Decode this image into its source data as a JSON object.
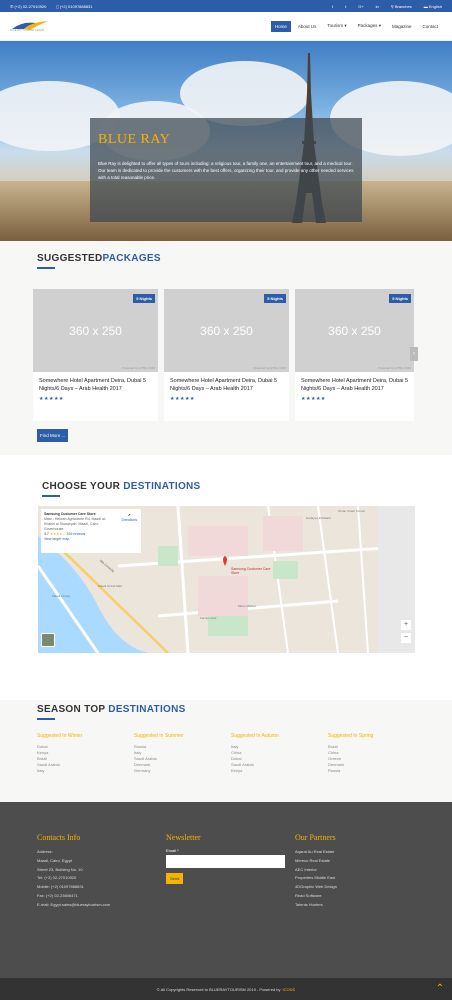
{
  "topbar": {
    "phone1": "(+2) 02-27010920",
    "phone2": "(+2) 01097888831",
    "social": [
      "f",
      "t",
      "G+",
      "in"
    ],
    "branches": "Branches",
    "language": "English"
  },
  "logo": {
    "text": "BLUE RAY TOURISM GROUP"
  },
  "menu": {
    "items": [
      "Home",
      "About Us",
      "Tourism",
      "Packages",
      "Magazine",
      "Contact"
    ]
  },
  "hero": {
    "title": "BLUE RAY",
    "desc": "Blue Ray is delighted to offer all types of tours including: a religious tour, a family one, an entertainment tour, and a medical tour. Our team is dedicated to provide the customers with the best offers, organizing their tour, and provide any other needed services with a total reasonable price."
  },
  "packages": {
    "title1": "SUGGESTED",
    "title2": "PACKAGES",
    "more": "Find More ...",
    "cards": [
      {
        "badge": "5 Nights",
        "img": "360 x 250",
        "powered": "Powered by HTML.COM",
        "title": "Somewhere Hotel Apartment Deira, Dubai 5 Nights/6 Days – Arab Health 2017",
        "stars": "★★★★★"
      },
      {
        "badge": "5 Nights",
        "img": "360 x 250",
        "powered": "Powered by HTML.COM",
        "title": "Somewhere Hotel Apartment Deira, Dubai 5 Nights/6 Days – Arab Health 2017",
        "stars": "★★★★★"
      },
      {
        "badge": "5 Nights",
        "img": "360 x 250",
        "powered": "Powered by HTML.COM",
        "title": "Somewhere Hotel Apartment Deira, Dubai 5 Nights/6 Days – Arab Health 2017",
        "stars": "★★★★★"
      }
    ]
  },
  "destinations": {
    "title1": "CHOOSE YOUR ",
    "title2": "DESTINATIONS"
  },
  "map": {
    "place": "Samsung Customer Care Store",
    "address": "Masr - Helwan Agriculture Rd, Maadi al-Khabiri al Sharqeyah, Maadi, Cairo Governorate",
    "rating": "3.7",
    "stars": "★★★★☆",
    "reviews": "326 reviews",
    "directions": "Directions",
    "larger": "View larger map",
    "pin_label": "Samsung Customer Care Store",
    "labels": [
      "Maadi Grand Mall",
      "Metro Market",
      "Family Land",
      "Maadi Library",
      "Hadayeq El Maadi",
      "Oman Smart School",
      "Nile Corniche"
    ]
  },
  "season": {
    "title1": "SEASON TOP ",
    "title2": "DESTINATIONS",
    "columns": [
      {
        "head": "Suggested In Winter",
        "items": [
          "Dubai",
          "Kenya",
          "Brazil",
          "Saudi Arabia",
          "Italy"
        ]
      },
      {
        "head": "Suggested In Summer",
        "items": [
          "Russia",
          "Italy",
          "Saudi Arabia",
          "Denmark",
          "Germany"
        ]
      },
      {
        "head": "Suggested In Autumn",
        "items": [
          "Italy",
          "China",
          "Dubai",
          "Saudi Arabia",
          "Kenya"
        ]
      },
      {
        "head": "Suggested In Spring",
        "items": [
          "Brazil",
          "China",
          "Greece",
          "Denmark",
          "Russia"
        ]
      }
    ]
  },
  "footer": {
    "contacts": {
      "head": "Contacts Info",
      "items": [
        "Address:",
        "Maadi, Cairo, Egypt",
        "Street 23, Building No. 10",
        "Tel: (+2) 02-27010920",
        "Mobile: (+2) 01097888831",
        "Fax: (+2) 02-23606471",
        "E-mail: Egypt.sales@blueraytourism.com"
      ]
    },
    "newsletter": {
      "head": "Newsletter",
      "email_label": "Email *",
      "send": "Send"
    },
    "partners": {
      "head": "Our Partners",
      "items": [
        "Aqarat Au Real Estate",
        "Mereco Real Estate",
        "AEC Interior",
        "Properties Middle East",
        "4DGraphic Web Design",
        "Read Software",
        "Talents Hunters"
      ]
    }
  },
  "copyright": {
    "text": "© All Copyrights Reserved to BLUERAYTOURISM 2019 - Powered by",
    "brand": "ICONS"
  }
}
